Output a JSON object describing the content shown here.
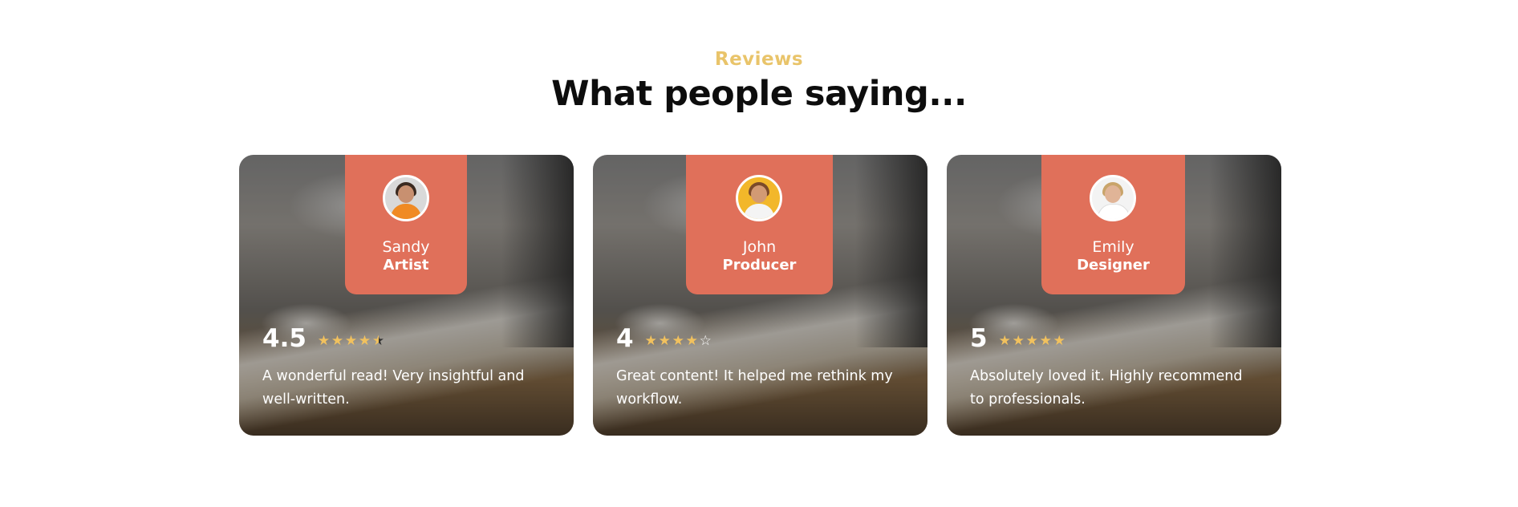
{
  "section": {
    "eyebrow": "Reviews",
    "title": "What people saying..."
  },
  "colors": {
    "accent": "#e9c46a",
    "tab": "#e0705a",
    "star": "#f1c15e"
  },
  "reviews": [
    {
      "name": "Sandy",
      "role": "Artist",
      "score": "4.5",
      "rating": 4.5,
      "text": "A wonderful read! Very insightful and well-written.",
      "avatar_icon": "person-orange-top-avatar"
    },
    {
      "name": "John",
      "role": "Producer",
      "score": "4",
      "rating": 4,
      "text": "Great content! It helped me rethink my workflow.",
      "avatar_icon": "bearded-man-yellow-bg-avatar"
    },
    {
      "name": "Emily",
      "role": "Designer",
      "score": "5",
      "rating": 5,
      "text": "Absolutely loved it. Highly recommend to professionals.",
      "avatar_icon": "woman-white-top-avatar"
    }
  ]
}
